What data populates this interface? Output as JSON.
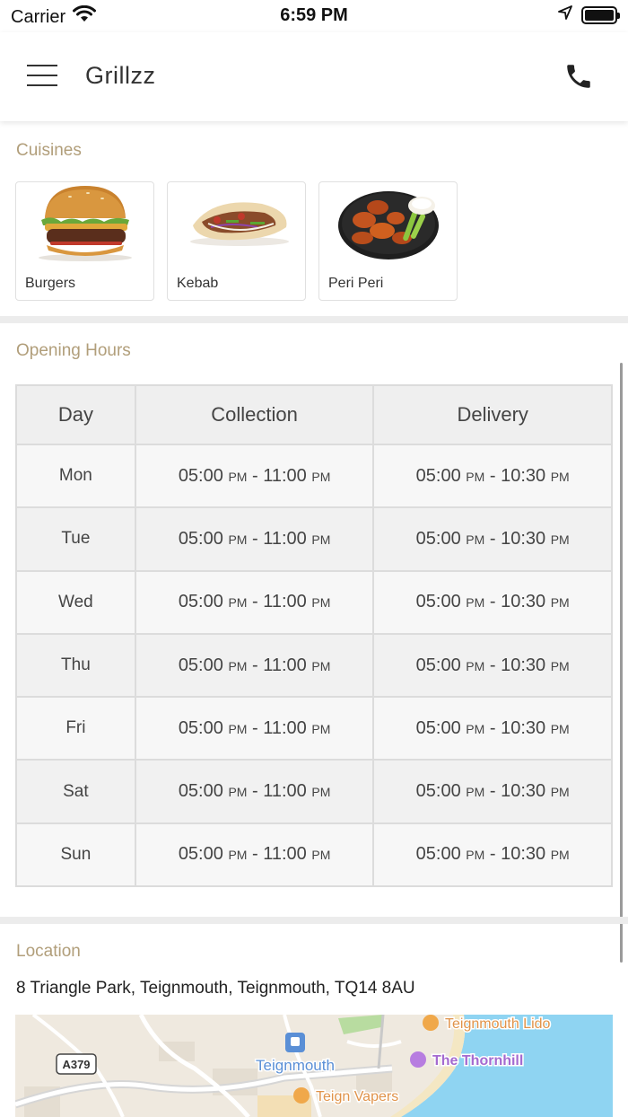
{
  "status_bar": {
    "carrier": "Carrier",
    "time": "6:59 PM"
  },
  "header": {
    "title": "Grillzz",
    "menu_icon": "hamburger-menu-icon",
    "call_icon": "phone-icon"
  },
  "cuisines": {
    "label": "Cuisines",
    "items": [
      {
        "name": "Burgers",
        "icon": "burger-image"
      },
      {
        "name": "Kebab",
        "icon": "kebab-image"
      },
      {
        "name": "Peri Peri",
        "icon": "peri-peri-wings-image"
      }
    ]
  },
  "opening_hours": {
    "label": "Opening Hours",
    "columns": [
      "Day",
      "Collection",
      "Delivery"
    ],
    "rows": [
      {
        "day": "Mon",
        "collection": {
          "open": "05:00",
          "open_suffix": "PM",
          "close": "11:00",
          "close_suffix": "PM"
        },
        "delivery": {
          "open": "05:00",
          "open_suffix": "PM",
          "close": "10:30",
          "close_suffix": "PM"
        }
      },
      {
        "day": "Tue",
        "collection": {
          "open": "05:00",
          "open_suffix": "PM",
          "close": "11:00",
          "close_suffix": "PM"
        },
        "delivery": {
          "open": "05:00",
          "open_suffix": "PM",
          "close": "10:30",
          "close_suffix": "PM"
        }
      },
      {
        "day": "Wed",
        "collection": {
          "open": "05:00",
          "open_suffix": "PM",
          "close": "11:00",
          "close_suffix": "PM"
        },
        "delivery": {
          "open": "05:00",
          "open_suffix": "PM",
          "close": "10:30",
          "close_suffix": "PM"
        }
      },
      {
        "day": "Thu",
        "collection": {
          "open": "05:00",
          "open_suffix": "PM",
          "close": "11:00",
          "close_suffix": "PM"
        },
        "delivery": {
          "open": "05:00",
          "open_suffix": "PM",
          "close": "10:30",
          "close_suffix": "PM"
        }
      },
      {
        "day": "Fri",
        "collection": {
          "open": "05:00",
          "open_suffix": "PM",
          "close": "11:00",
          "close_suffix": "PM"
        },
        "delivery": {
          "open": "05:00",
          "open_suffix": "PM",
          "close": "10:30",
          "close_suffix": "PM"
        }
      },
      {
        "day": "Sat",
        "collection": {
          "open": "05:00",
          "open_suffix": "PM",
          "close": "11:00",
          "close_suffix": "PM"
        },
        "delivery": {
          "open": "05:00",
          "open_suffix": "PM",
          "close": "10:30",
          "close_suffix": "PM"
        }
      },
      {
        "day": "Sun",
        "collection": {
          "open": "05:00",
          "open_suffix": "PM",
          "close": "11:00",
          "close_suffix": "PM"
        },
        "delivery": {
          "open": "05:00",
          "open_suffix": "PM",
          "close": "10:30",
          "close_suffix": "PM"
        }
      }
    ]
  },
  "location": {
    "label": "Location",
    "address": "8 Triangle Park, Teignmouth, Teignmouth, TQ14 8AU",
    "map": {
      "road_label": "A379",
      "town_label": "Teignmouth",
      "places": [
        "Teignmouth Lido",
        "The Thornhill",
        "Teign Vapers"
      ]
    }
  },
  "colors": {
    "section_label": "#b19e7a",
    "divider": "#ececec",
    "sea": "#8fd4f2"
  }
}
